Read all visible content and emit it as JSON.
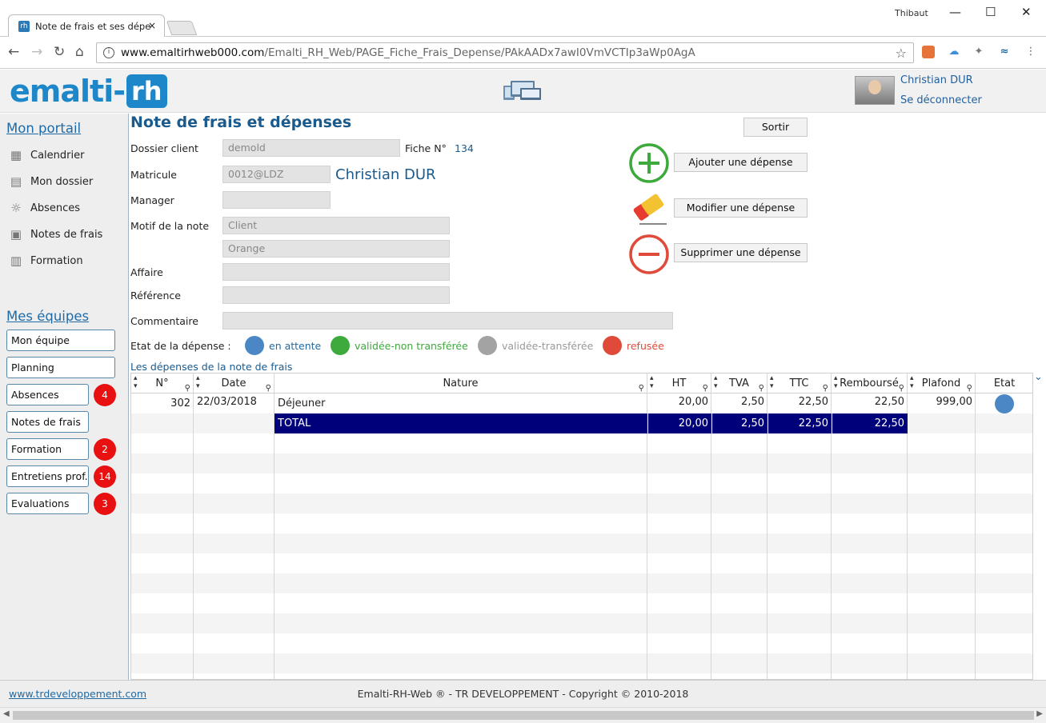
{
  "browser": {
    "tab_title": "Note de frais et ses dépe",
    "tab_close": "×",
    "window_user": "Thibaut",
    "url_domain": "www.emaltirhweb000.com",
    "url_path": "/Emalti_RH_Web/PAGE_Fiche_Frais_Depense/PAkAADx7awI0VmVCTIp3aWp0AgA"
  },
  "header": {
    "logo_text": "emalti-",
    "logo_box": "rh",
    "user_name": "Christian DUR",
    "logout": "Se déconnecter"
  },
  "sidebar": {
    "portal_title": "Mon portail",
    "portal_items": [
      {
        "label": "Calendrier",
        "icon": "calendar-icon"
      },
      {
        "label": "Mon dossier",
        "icon": "id-card-icon"
      },
      {
        "label": "Absences",
        "icon": "sun-icon"
      },
      {
        "label": "Notes de frais",
        "icon": "receipt-icon"
      },
      {
        "label": "Formation",
        "icon": "book-icon"
      }
    ],
    "teams_title": "Mes équipes",
    "team_buttons": [
      {
        "label": "Mon équipe",
        "badge": ""
      },
      {
        "label": "Planning",
        "badge": ""
      },
      {
        "label": "Absences",
        "badge": "4"
      },
      {
        "label": "Notes de frais",
        "badge": ""
      },
      {
        "label": "Formation",
        "badge": "2"
      },
      {
        "label": "Entretiens prof.",
        "badge": "14"
      },
      {
        "label": "Evaluations",
        "badge": "3"
      }
    ]
  },
  "form": {
    "title": "Note de frais et dépenses",
    "dossier_label": "Dossier client",
    "dossier_value": "demold",
    "fiche_label": "Fiche N°",
    "fiche_value": "134",
    "matricule_label": "Matricule",
    "matricule_value": "0012@LDZ",
    "employee_name": "Christian DUR",
    "manager_label": "Manager",
    "manager_value": "",
    "motif_label": "Motif de la note",
    "motif_value1": "Client",
    "motif_value2": "Orange",
    "affaire_label": "Affaire",
    "affaire_value": "",
    "reference_label": "Référence",
    "reference_value": "",
    "commentaire_label": "Commentaire",
    "commentaire_value": ""
  },
  "actions": {
    "sortir": "Sortir",
    "ajouter": "Ajouter une dépense",
    "modifier": "Modifier une dépense",
    "supprimer": "Supprimer une dépense"
  },
  "legend": {
    "label": "Etat de la dépense :",
    "items": [
      {
        "label": "en attente",
        "color": "#4a87c4"
      },
      {
        "label": "validée-non transférée",
        "color": "#3eaa3e"
      },
      {
        "label": "validée-transférée",
        "color": "#a3a3a3"
      },
      {
        "label": "refusée",
        "color": "#e04a3a"
      }
    ]
  },
  "table": {
    "caption": "Les dépenses de la note de frais",
    "columns": [
      "N°",
      "Date",
      "Nature",
      "HT",
      "TVA",
      "TTC",
      "Remboursé",
      "Plafond",
      "Etat"
    ],
    "rows": [
      {
        "num": "302",
        "date": "22/03/2018",
        "nature": "Déjeuner",
        "ht": "20,00",
        "tva": "2,50",
        "ttc": "22,50",
        "rembourse": "22,50",
        "plafond": "999,00",
        "etat": "en attente"
      }
    ],
    "total": {
      "label": "TOTAL",
      "ht": "20,00",
      "tva": "2,50",
      "ttc": "22,50",
      "rembourse": "22,50"
    }
  },
  "footer": {
    "link": "www.trdeveloppement.com",
    "copyright": "Emalti-RH-Web ® - TR DEVELOPPEMENT - Copyright © 2010-2018"
  }
}
